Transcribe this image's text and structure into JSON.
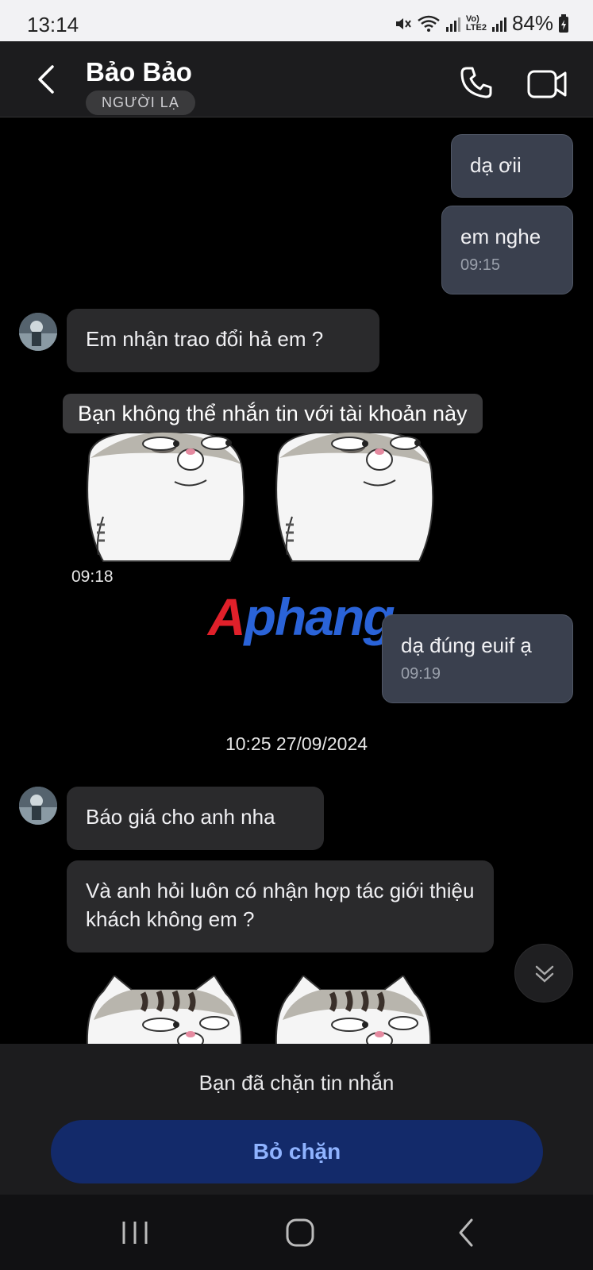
{
  "status_bar": {
    "time": "13:14",
    "battery": "84%",
    "network_label_1": "Vo)",
    "network_label_2": "LTE2"
  },
  "header": {
    "name": "Bảo Bảo",
    "badge": "NGƯỜI LẠ"
  },
  "messages": [
    {
      "direction": "outgoing",
      "text": "dạ ơii"
    },
    {
      "direction": "outgoing",
      "text": "em nghe",
      "time": "09:15"
    },
    {
      "direction": "incoming",
      "text": "Em nhận trao đổi hả em ?"
    },
    {
      "direction": "system",
      "text": "Bạn không thể nhắn tin với tài khoản này"
    },
    {
      "direction": "incoming",
      "type": "sticker",
      "time": "09:18"
    },
    {
      "direction": "outgoing",
      "text": "dạ đúng euif ạ",
      "time": "09:19"
    },
    {
      "direction": "incoming",
      "text": "Báo giá cho anh nha"
    },
    {
      "direction": "incoming",
      "text": "Và anh hỏi luôn có nhận hợp tác giới thiệu khách không em ?"
    },
    {
      "direction": "incoming",
      "type": "sticker"
    }
  ],
  "date_divider": "10:25 27/09/2024",
  "watermark": {
    "part1": "A",
    "part2": "phang"
  },
  "blocked": {
    "notice": "Bạn đã chặn tin nhắn",
    "unblock_label": "Bỏ chặn"
  },
  "colors": {
    "outgoing_bubble": "#3a404e",
    "incoming_bubble": "#2a2a2c",
    "unblock_button": "#132a6a",
    "unblock_text": "#8fb3ff"
  }
}
